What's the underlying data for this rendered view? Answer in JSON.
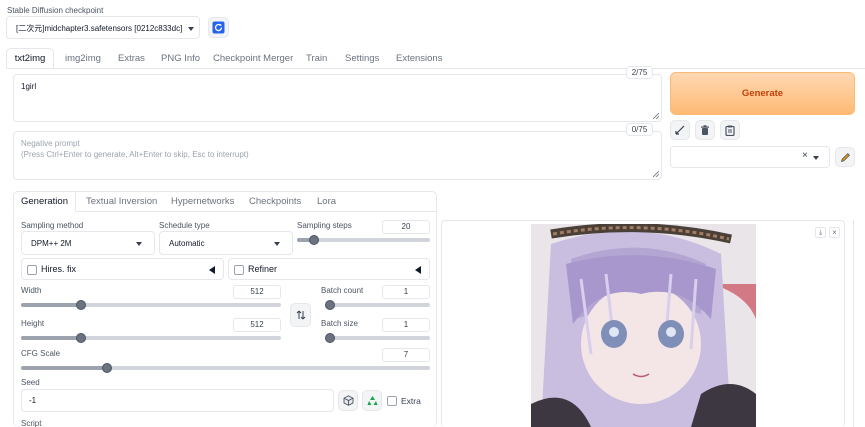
{
  "checkpoint": {
    "label": "Stable Diffusion checkpoint",
    "value": "[二次元]midchapter3.safetensors [0212c833dc]"
  },
  "main_tabs": [
    {
      "label": "txt2img",
      "active": true
    },
    {
      "label": "img2img"
    },
    {
      "label": "Extras"
    },
    {
      "label": "PNG Info"
    },
    {
      "label": "Checkpoint Merger"
    },
    {
      "label": "Train"
    },
    {
      "label": "Settings"
    },
    {
      "label": "Extensions"
    }
  ],
  "prompt": {
    "value": "1girl",
    "token_count": "2/75"
  },
  "negative_prompt": {
    "placeholder_line1": "Negative prompt",
    "placeholder_line2": "(Press Ctrl+Enter to generate, Alt+Enter to skip, Esc to interrupt)",
    "token_count": "0/75"
  },
  "generate_label": "Generate",
  "sub_tabs": [
    {
      "label": "Generation",
      "active": true
    },
    {
      "label": "Textual Inversion"
    },
    {
      "label": "Hypernetworks"
    },
    {
      "label": "Checkpoints"
    },
    {
      "label": "Lora"
    }
  ],
  "sampling_method": {
    "label": "Sampling method",
    "value": "DPM++ 2M"
  },
  "schedule_type": {
    "label": "Schedule type",
    "value": "Automatic"
  },
  "sampling_steps": {
    "label": "Sampling steps",
    "value": "20",
    "fraction": 0.13
  },
  "hires_fix": {
    "label": "Hires. fix"
  },
  "refiner": {
    "label": "Refiner"
  },
  "width": {
    "label": "Width",
    "value": "512",
    "fraction": 0.23
  },
  "height": {
    "label": "Height",
    "value": "512",
    "fraction": 0.23
  },
  "batch_count": {
    "label": "Batch count",
    "value": "1",
    "fraction": 0.0
  },
  "batch_size": {
    "label": "Batch size",
    "value": "1",
    "fraction": 0.0
  },
  "cfg_scale": {
    "label": "CFG Scale",
    "value": "7",
    "fraction": 0.21
  },
  "seed": {
    "label": "Seed",
    "value": "-1"
  },
  "extra_label": "Extra",
  "script_label": "Script",
  "colors": {
    "generate_gradient_from": "#fed7aa",
    "generate_gradient_to": "#fdba74",
    "generate_text": "#c2410c"
  },
  "icons": [
    "refresh-icon",
    "check-icon",
    "trash-icon",
    "clipboard-icon",
    "pencil-icon",
    "swap-icon",
    "dice-icon",
    "recycle-icon",
    "download-icon",
    "close-icon"
  ]
}
